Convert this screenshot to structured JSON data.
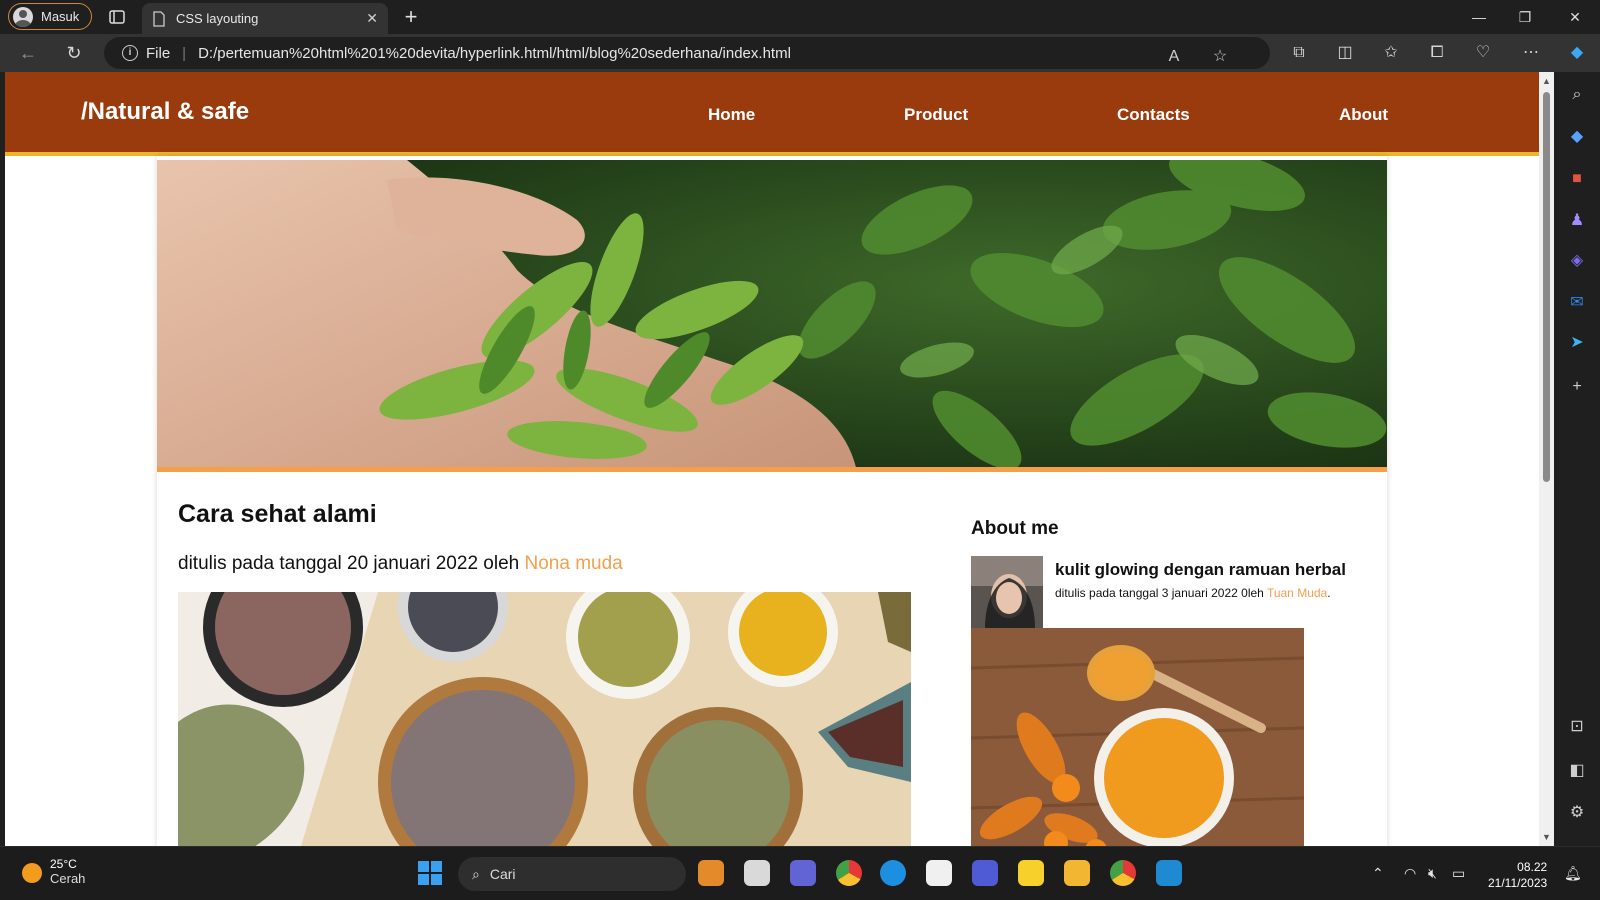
{
  "browser": {
    "profile_label": "Masuk",
    "tab_title": "CSS layouting",
    "address_scheme": "File",
    "url": "D:/pertemuan%20html%201%20devita/hyperlink.html/html/blog%20sederhana/index.html"
  },
  "site": {
    "logo": "/Natural & safe",
    "nav": [
      "Home",
      "Product",
      "Contacts",
      "About"
    ],
    "post": {
      "title": "Cara sehat alami",
      "meta_prefix": "ditulis pada tanggal 20 januari 2022 oleh ",
      "author": "Nona muda"
    },
    "sidebar": {
      "heading": "About me",
      "article_title": "kulit glowing dengan ramuan herbal",
      "meta_prefix": "ditulis pada tanggal 3 januari 2022 0leh ",
      "author": "Tuan Muda",
      "meta_suffix": "."
    }
  },
  "taskbar": {
    "weather_temp": "25°C",
    "weather_cond": "Cerah",
    "search_placeholder": "Cari",
    "time": "08.22",
    "date": "21/11/2023"
  },
  "colors": {
    "header_bg": "#9a3b0e",
    "header_border": "#f0b42a",
    "author_link": "#f2a04d",
    "hero_border": "#f4a04a"
  }
}
